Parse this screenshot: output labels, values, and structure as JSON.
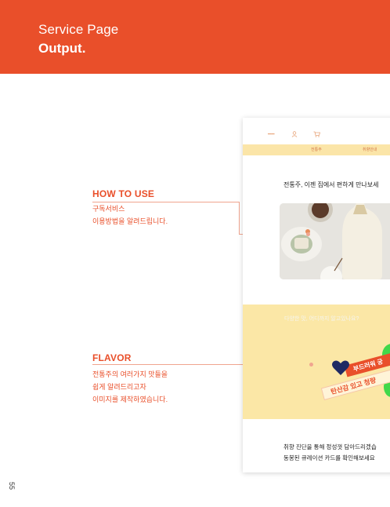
{
  "header": {
    "title": "Service Page",
    "subtitle": "Output."
  },
  "annotations": {
    "how_to_use": {
      "title": "HOW TO USE",
      "lines": [
        "구독서비스",
        "이용방법을 알려드립니다."
      ]
    },
    "flavor": {
      "title": "FLAVOR",
      "lines": [
        "전통주의 여러가지 맛들을",
        "쉽게 알려드리고자",
        "이미지를 제작하였습니다."
      ]
    }
  },
  "page_number": "55",
  "mockup": {
    "nav_items": [
      "전통주",
      "취향안내"
    ],
    "lead_text": "전통주, 이젠 집에서 편하게 만나보세",
    "flavor_question": "다양한 맛, 어디까지 알고있나요?",
    "sticker_red": "부드러워 궁",
    "sticker_cream": "탄산감 있고 청량",
    "bottom_line1": "취향 진단을 통해 정성껏 담아드리겠습",
    "bottom_line2": "동봉된 큐레이션 카드를 확인해보세요"
  },
  "colors": {
    "accent": "#e94f2a",
    "yellow": "#fbe7a6",
    "green": "#41d84a",
    "navy": "#1f2a63"
  },
  "icons": [
    "menu-icon",
    "user-icon",
    "cart-icon"
  ]
}
